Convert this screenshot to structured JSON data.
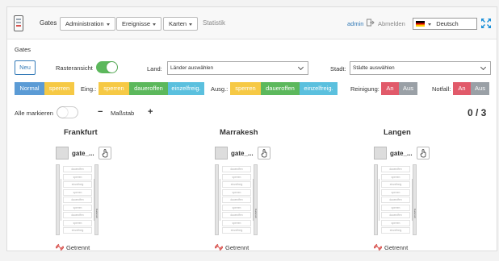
{
  "nav": {
    "brand": "Gates",
    "menus": [
      "Administration",
      "Ereignisse",
      "Karten"
    ],
    "statistik": "Statistik",
    "user": "admin",
    "logout": "Abmelden",
    "language": "Deutsch"
  },
  "breadcrumb": "Gates",
  "toolbar": {
    "new_label": "Neu",
    "grid_view_label": "Rasteransicht",
    "grid_view_on": true,
    "land_label": "Land:",
    "land_placeholder": "Länder auswählen",
    "city_label": "Stadt:",
    "city_placeholder": "Städte auswählen"
  },
  "modes": {
    "normal": "Normal",
    "sperren": "sperren",
    "entry_label": "Eing.:",
    "exit_label": "Ausg.:",
    "entry_options": [
      "sperren",
      "daueroffen",
      "einzelfreig."
    ],
    "exit_options": [
      "sperren",
      "daueroffen",
      "einzelfreig."
    ],
    "cleaning_label": "Reinigung:",
    "emergency_label": "Notfall:",
    "on": "An",
    "off": "Aus"
  },
  "selection": {
    "select_all_label": "Alle markieren",
    "select_all_on": false,
    "minus": "−",
    "scale_label": "Maßstab",
    "plus": "+",
    "counter": "0 / 3"
  },
  "lanes": [
    "daueroffen",
    "sperren",
    "einzelfreig",
    "sperren",
    "daueroffen",
    "sperren",
    "daueroffen",
    "sperren",
    "einzelfreig"
  ],
  "rail_text": "Gatecom",
  "gates": [
    {
      "location": "Frankfurt",
      "name": "gate_...",
      "status": "Getrennt"
    },
    {
      "location": "Marrakesh",
      "name": "gate_...",
      "status": "Getrennt"
    },
    {
      "location": "Langen",
      "name": "gate_...",
      "status": "Getrennt"
    }
  ],
  "colors": {
    "primary": "#337ab7",
    "success": "#5cb85c",
    "warning": "#f6c945",
    "info": "#5bc0de",
    "danger": "#e15a6a"
  }
}
